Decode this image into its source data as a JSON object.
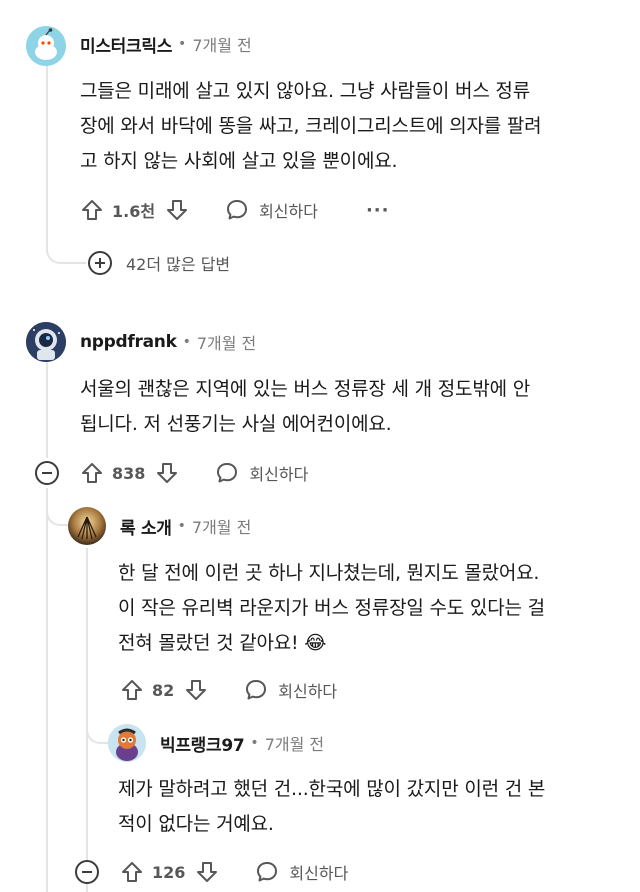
{
  "comments": [
    {
      "username": "미스터크릭스",
      "timestamp": "7개월 전",
      "lines": [
        "그들은 미래에 살고 있지 않아요. 그냥 사람들이 버스 정류",
        "장에 와서 바닥에 똥을 싸고, 크레이그리스트에 의자를 팔려",
        "고 하지 않는 사회에 살고 있을 뿐이에요."
      ],
      "score": "1.6천",
      "reply_label": "회신하다",
      "more_replies": "42더 많은 답변"
    },
    {
      "username": "nppdfrank",
      "timestamp": "7개월 전",
      "lines": [
        "서울의 괜찮은 지역에 있는 버스 정류장 세 개 정도밖에 안",
        "됩니다. 저 선풍기는 사실 에어컨이에요."
      ],
      "score": "838",
      "reply_label": "회신하다"
    },
    {
      "username": "록 소개",
      "timestamp": "7개월 전",
      "lines": [
        "한 달 전에 이런 곳 하나 지나쳤는데, 뭔지도 몰랐어요.",
        "이 작은 유리벽 라운지가 버스 정류장일 수도 있다는 걸",
        "전혀 몰랐던 것 같아요! 😂"
      ],
      "score": "82",
      "reply_label": "회신하다"
    },
    {
      "username": "빅프랭크97",
      "timestamp": "7개월 전",
      "lines": [
        "제가 말하려고 했던 건...한국에 많이 갔지만 이런 건 본",
        "적이 없다는 거예요."
      ],
      "score": "126",
      "reply_label": "회신하다"
    }
  ],
  "separator": "•",
  "more_icon": "···"
}
